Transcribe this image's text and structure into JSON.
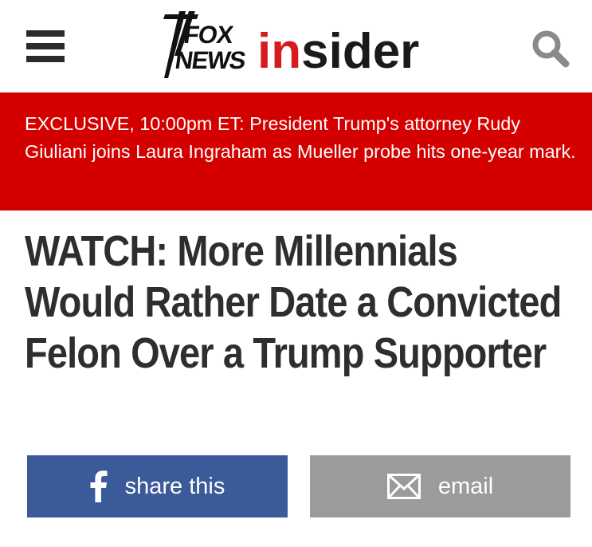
{
  "header": {
    "logo": {
      "fox": "FOX",
      "news": "NEWS",
      "insider_in": "in",
      "insider_sider": "sider"
    },
    "menu_icon": "hamburger-menu-icon",
    "search_icon": "search-icon"
  },
  "banner": {
    "text": "EXCLUSIVE, 10:00pm ET: President Trump's attorney Rudy Giuliani joins Laura Ingraham as Mueller probe hits one-year mark.",
    "background": "#d40000"
  },
  "article": {
    "headline": "WATCH: More Millennials Would Rather Date a Convicted Felon Over a Trump Supporter"
  },
  "share": {
    "facebook_label": "share this",
    "facebook_icon": "facebook-icon",
    "facebook_color": "#3b5a9a",
    "email_label": "email",
    "email_icon": "envelope-icon",
    "email_color": "#9b9b9b"
  },
  "colors": {
    "brand_red": "#d71a1f",
    "text_dark": "#2e2e2e"
  }
}
